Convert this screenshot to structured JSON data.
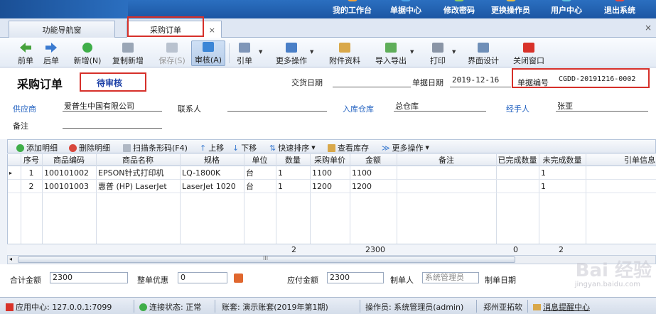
{
  "topnav": [
    "我的工作台",
    "单据中心",
    "修改密码",
    "更换操作员",
    "用户中心",
    "退出系统"
  ],
  "tabs": [
    {
      "label": "功能导航窗"
    },
    {
      "label": "采购订单",
      "close": "×"
    }
  ],
  "tabstrip_close": "×",
  "toolbar": {
    "prev": "前单",
    "next": "后单",
    "add": "新增(N)",
    "copy_add": "复制新增",
    "save": "保存(S)",
    "audit": "审核(A)",
    "import_ref": "引单",
    "more": "更多操作",
    "attach": "附件资料",
    "import_export": "导入导出",
    "print": "打印",
    "ui_design": "界面设计",
    "close": "关闭窗口"
  },
  "header": {
    "title": "采购订单",
    "status": "待审核",
    "delivery_date_label": "交货日期",
    "delivery_date": "",
    "doc_date_label": "单据日期",
    "doc_date": "2019-12-16",
    "doc_no_label": "单据编号",
    "doc_no": "CGDD-20191216-0002"
  },
  "form": {
    "supplier_label": "供应商",
    "supplier": "爱普生中国有限公司",
    "contact_label": "联系人",
    "contact": "",
    "warehouse_label": "入库仓库",
    "warehouse": "总仓库",
    "handler_label": "经手人",
    "handler": "张亚",
    "remark_label": "备注",
    "remark": ""
  },
  "gridbar": {
    "add_row": "添加明细",
    "del_row": "删除明细",
    "scan": "扫描条形码(F4)",
    "up": "上移",
    "down": "下移",
    "sort": "快速排序",
    "stock": "查看库存",
    "more": "更多操作"
  },
  "grid": {
    "columns": [
      "序号",
      "商品编码",
      "商品名称",
      "规格",
      "单位",
      "数量",
      "采购单价",
      "金额",
      "备注",
      "已完成数量",
      "未完成数量",
      "引单信息"
    ],
    "rows": [
      [
        "1",
        "100101002",
        "EPSON针式打印机",
        "LQ-1800K",
        "台",
        "1",
        "1100",
        "1100",
        "",
        "",
        "1",
        ""
      ],
      [
        "2",
        "100101003",
        "惠普 (HP) LaserJet",
        "LaserJet 1020",
        "台",
        "1",
        "1200",
        "1200",
        "",
        "",
        "1",
        ""
      ]
    ],
    "row_marker": "▸",
    "summary": {
      "qty": "2",
      "amount": "2300",
      "done": "0",
      "undone": "2"
    },
    "scroll_marker": "III"
  },
  "footer": {
    "total_label": "合计金额",
    "total": "2300",
    "discount_label": "整单优惠",
    "discount": "0",
    "payable_label": "应付金额",
    "payable": "2300",
    "creator_label": "制单人",
    "creator": "系统管理员",
    "create_date_label": "制单日期"
  },
  "statusbar": {
    "app_center": "应用中心: 127.0.0.1:7099",
    "conn": "连接状态: 正常",
    "account": "账套: 演示账套(2019年第1期)",
    "operator": "操作员: 系统管理员(admin)",
    "company": "郑州亚拓软",
    "msg": "消息提醒中心"
  },
  "watermark": {
    "main": "Bai 经验",
    "sub": "jingyan.baidu.com"
  }
}
